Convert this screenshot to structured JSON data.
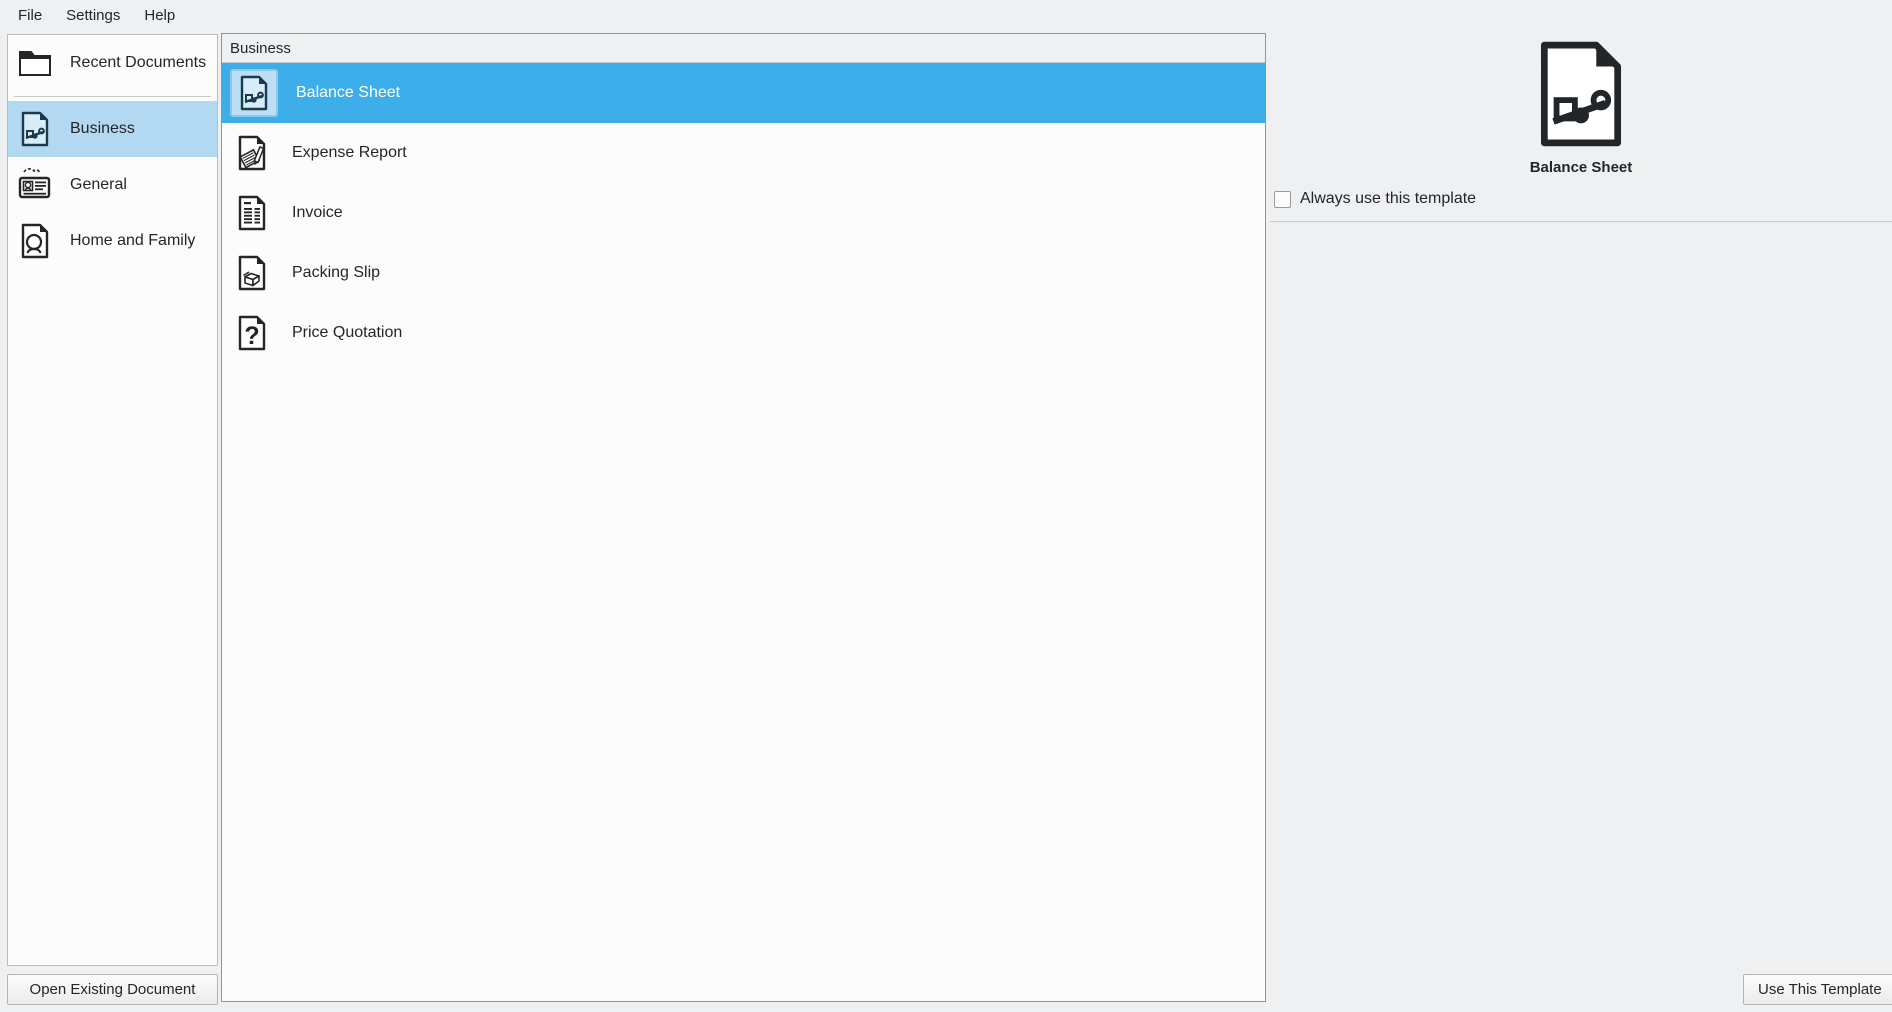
{
  "menubar": {
    "items": [
      {
        "label": "File",
        "name": "menu-file"
      },
      {
        "label": "Settings",
        "name": "menu-settings"
      },
      {
        "label": "Help",
        "name": "menu-help"
      }
    ]
  },
  "sidebar": {
    "items": [
      {
        "label": "Recent Documents",
        "icon": "folder-icon",
        "selected": false
      },
      {
        "label": "Business",
        "icon": "business-document-icon",
        "selected": true
      },
      {
        "label": "General",
        "icon": "id-card-icon",
        "selected": false
      },
      {
        "label": "Home and Family",
        "icon": "person-document-icon",
        "selected": false
      }
    ],
    "open_existing_label": "Open Existing Document"
  },
  "main": {
    "header": "Business",
    "templates": [
      {
        "label": "Balance Sheet",
        "icon": "balance-sheet-icon",
        "selected": true
      },
      {
        "label": "Expense Report",
        "icon": "expense-report-icon",
        "selected": false
      },
      {
        "label": "Invoice",
        "icon": "invoice-icon",
        "selected": false
      },
      {
        "label": "Packing Slip",
        "icon": "packing-slip-icon",
        "selected": false
      },
      {
        "label": "Price Quotation",
        "icon": "price-quotation-icon",
        "selected": false
      }
    ]
  },
  "preview": {
    "title": "Balance Sheet",
    "icon": "balance-sheet-icon",
    "always_use_label": "Always use this template",
    "always_use_checked": false,
    "use_template_label": "Use This Template"
  },
  "colors": {
    "selection": "#3daee9",
    "sidebar_selection": "#b3d9f2",
    "window_bg": "#eff0f1",
    "panel_bg": "#fcfcfc",
    "text": "#232629"
  }
}
